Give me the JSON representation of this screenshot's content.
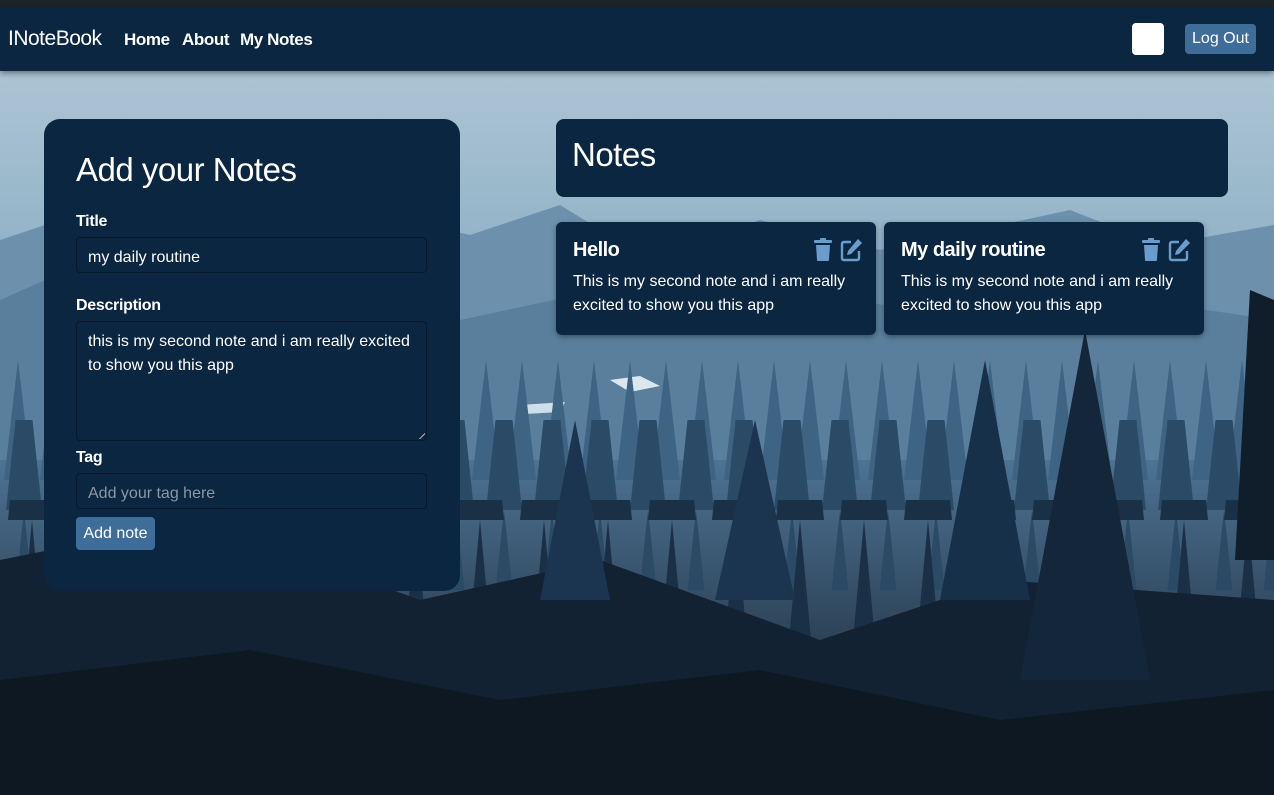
{
  "navbar": {
    "brand": "INoteBook",
    "links": [
      "Home",
      "About",
      "My Notes"
    ],
    "logout_label": "Log Out"
  },
  "form": {
    "heading": "Add your Notes",
    "title_label": "Title",
    "title_value": "my daily routine",
    "description_label": "Description",
    "description_value": "this is my second note and i am really excited to show you this app",
    "tag_label": "Tag",
    "tag_value": "",
    "tag_placeholder": "Add your tag here",
    "submit_label": "Add note"
  },
  "notes": {
    "heading": "Notes",
    "items": [
      {
        "title": "Hello",
        "description": "This is my second note and i am really excited to show you this app"
      },
      {
        "title": "My daily routine",
        "description": "This is my second note and i am really excited to show you this app"
      }
    ]
  },
  "colors": {
    "navbar": "#0b2640",
    "card": "#0b2640",
    "button": "#3d6d98",
    "icon": "#6a9dcc"
  },
  "icons": [
    "trash-icon",
    "edit-icon"
  ]
}
